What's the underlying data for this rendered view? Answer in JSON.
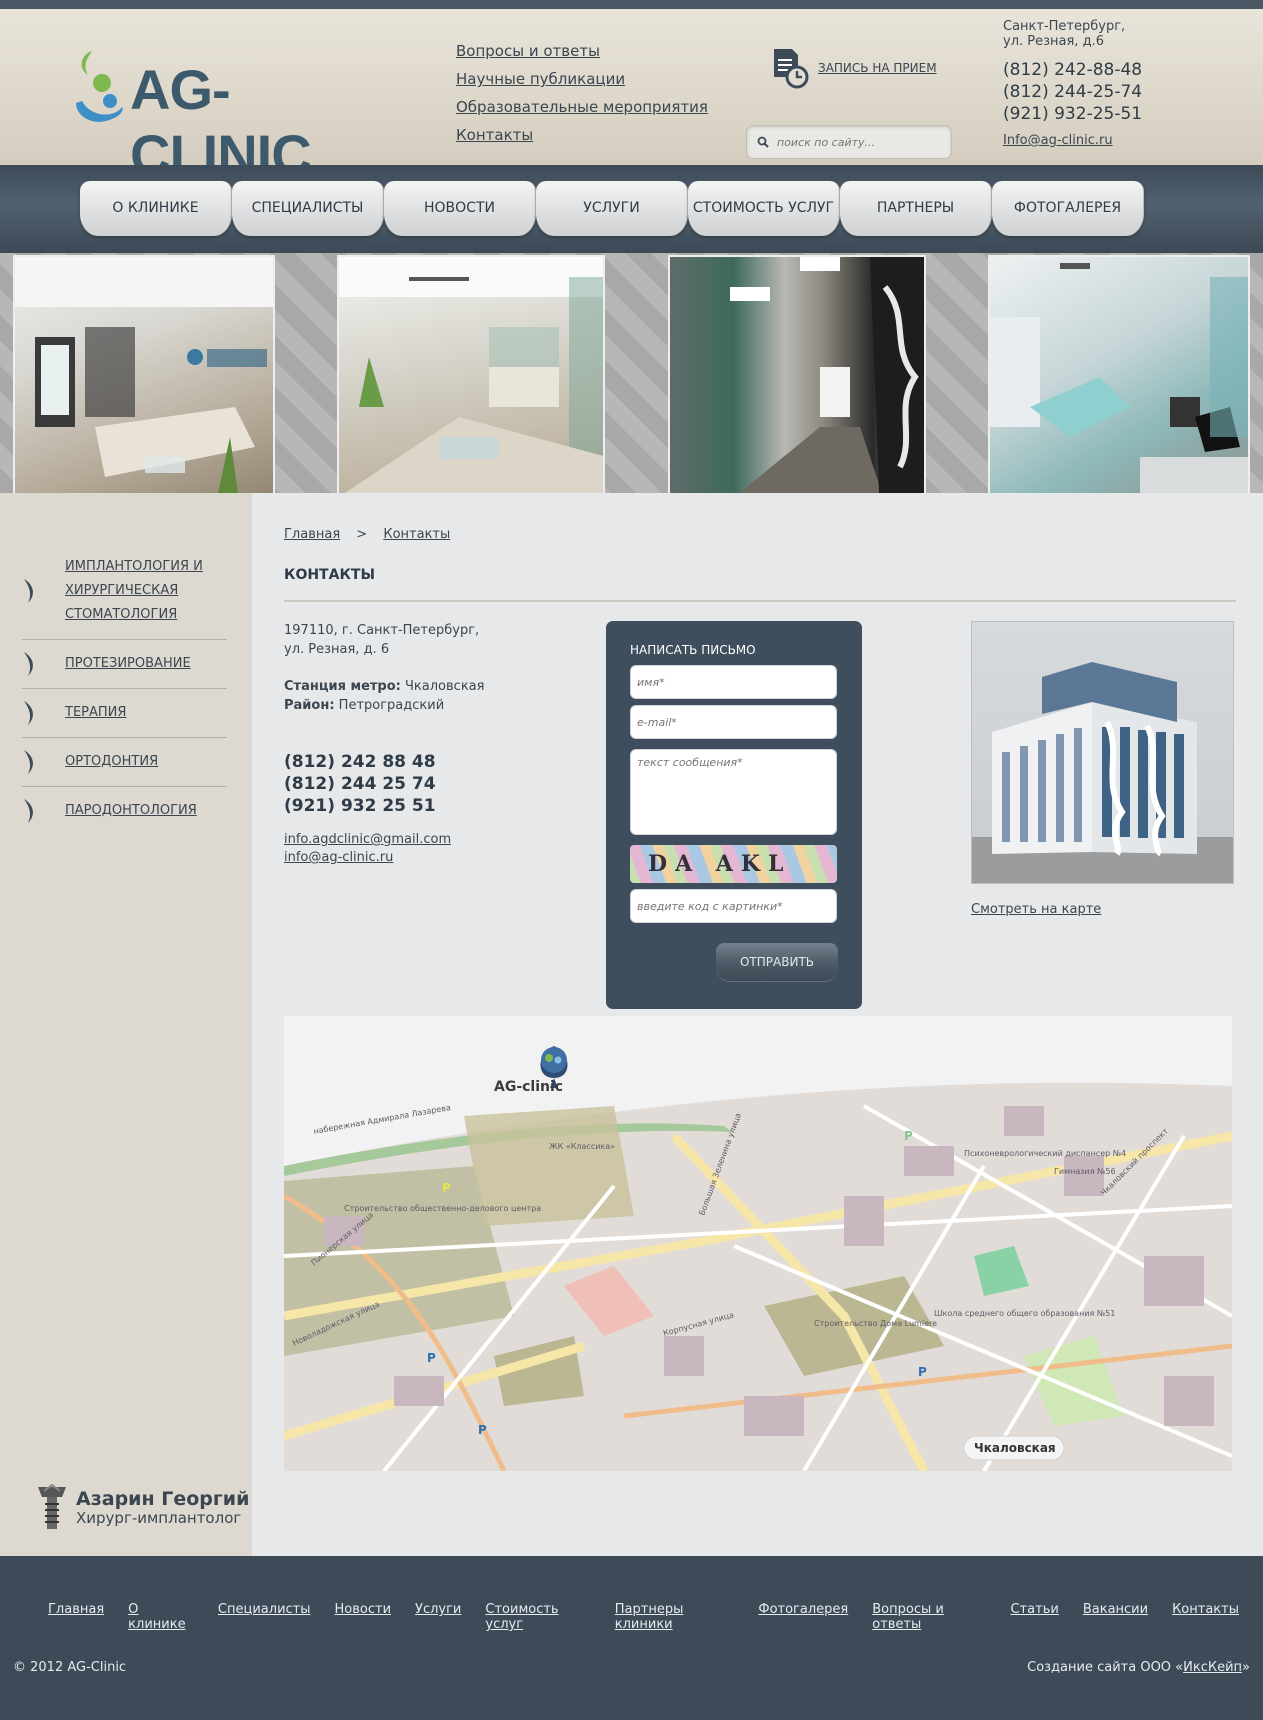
{
  "header": {
    "logo_text": "AG-CLINIC",
    "top_links": [
      "Вопросы и ответы",
      "Научные публикации",
      "Образовательные мероприятия",
      "Контакты"
    ],
    "appointment_label": "ЗАПИСЬ НА ПРИЕМ",
    "search_placeholder": "поиск по сайту...",
    "address_line1": "Санкт-Петербург,",
    "address_line2": "ул. Резная, д.6",
    "phones": [
      "(812) 242-88-48",
      "(812) 244-25-74",
      "(921) 932-25-51"
    ],
    "email": "Info@ag-clinic.ru"
  },
  "nav": [
    "О КЛИНИКЕ",
    "СПЕЦИАЛИСТЫ",
    "НОВОСТИ",
    "УСЛУГИ",
    "СТОИМОСТЬ УСЛУГ",
    "ПАРТНЕРЫ КЛИНИКИ",
    "ФОТОГАЛЕРЕЯ"
  ],
  "sidebar": {
    "items": [
      "ИМПЛАНТОЛОГИЯ И ХИРУРГИЧЕСКАЯ СТОМАТОЛОГИЯ",
      "ПРОТЕЗИРОВАНИЕ",
      "ТЕРАПИЯ",
      "ОРТОДОНТИЯ",
      "ПАРОДОНТОЛОГИЯ"
    ],
    "doctor_name": "Азарин Георгий",
    "doctor_role": "Хирург-имплантолог"
  },
  "breadcrumb": {
    "home": "Главная",
    "separator": ">",
    "current": "Контакты"
  },
  "page_title": "КОНТАКТЫ",
  "contact": {
    "address1": "197110, г. Санкт-Петербург,",
    "address2": "ул. Резная, д. 6",
    "metro_label": "Станция метро:",
    "metro_value": "Чкаловская",
    "district_label": "Район:",
    "district_value": "Петроградский",
    "phones": [
      "(812) 242 88 48",
      "(812) 244 25 74",
      "(921) 932 25 51"
    ],
    "emails": [
      "info.agdclinic@gmail.com",
      "info@ag-clinic.ru"
    ]
  },
  "form": {
    "title": "НАПИСАТЬ ПИСЬМО",
    "name_placeholder": "имя*",
    "email_placeholder": "e-mail*",
    "message_placeholder": "текст сообщения*",
    "captcha_text": "DA AKL",
    "code_placeholder": "введите код с картинки*",
    "submit_label": "ОТПРАВИТЬ"
  },
  "map_link": "Смотреть на карте",
  "map": {
    "marker_label": "AG-clinic",
    "station_label": "Чкаловская",
    "labels": [
      "набережная Адмирала Лазарева",
      "ЖК «Классика»",
      "Строительство общественно-делового центра",
      "Пионерская улица",
      "Новоладожская улица",
      "Большая Зеленина улица",
      "Строительство Дома Lumiere",
      "Корпусная улица",
      "Чкаловский проспект",
      "Гимназия №56",
      "Психоневрологический диспансер №4",
      "Школа среднего общего образования №51"
    ]
  },
  "footer": {
    "links": [
      "Главная",
      "О клинике",
      "Специалисты",
      "Новости",
      "Услуги",
      "Стоимость услуг",
      "Партнеры клиники",
      "Фотогалерея",
      "Вопросы и ответы",
      "Статьи",
      "Вакансии",
      "Контакты"
    ],
    "copyright": "© 2012 AG-Clinic",
    "made_prefix": "Создание сайта ООО «",
    "made_company": "ИксКейп",
    "made_suffix": "»"
  },
  "colors": {
    "dark": "#3d4b59",
    "header_bg": "#e2ddd2",
    "sidebar_bg": "#ddd9d0",
    "logo_blue": "#3d5a6c",
    "logo_green": "#7fb84d"
  }
}
